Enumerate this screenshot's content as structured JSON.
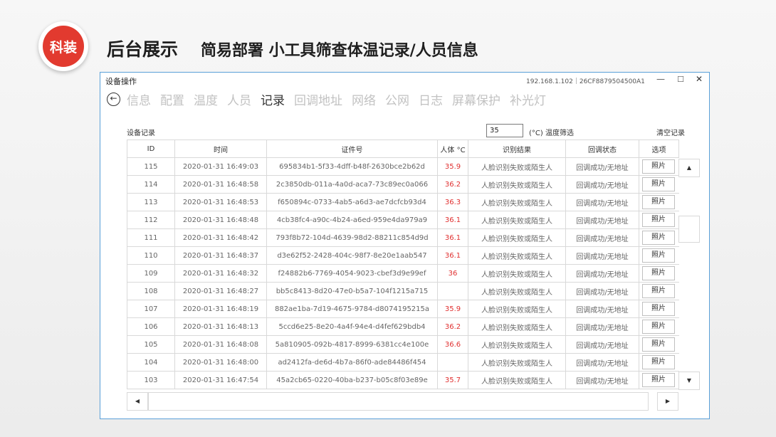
{
  "slide": {
    "badge": "科装",
    "title": "后台展示",
    "subtitle": "简易部署 小工具筛查体温记录/人员信息"
  },
  "window": {
    "title": "设备操作",
    "device_info": "192.168.1.102｜26CF8879504500A1",
    "controls": {
      "minimize": "—",
      "maximize": "☐",
      "close": "✕"
    }
  },
  "nav": {
    "back_icon": "←",
    "tabs": [
      "信息",
      "配置",
      "温度",
      "人员",
      "记录",
      "回调地址",
      "网络",
      "公网",
      "日志",
      "屏幕保护",
      "补光灯"
    ],
    "active_index": 4
  },
  "records": {
    "label": "设备记录",
    "temp_filter_value": "35",
    "temp_filter_label": "(°C) 温度筛选",
    "clear_label": "清空记录",
    "columns": [
      "ID",
      "时间",
      "证件号",
      "人体 °C",
      "识别结果",
      "回调状态",
      "选项"
    ],
    "photo_label": "照片",
    "rows": [
      {
        "id": "115",
        "time": "2020-01-31 16:49:03",
        "cert": "695834b1-5f33-4dff-b48f-2630bce2b62d",
        "temp": "35.9",
        "result": "人脸识别失败或陌生人",
        "callback": "回调成功/无地址"
      },
      {
        "id": "114",
        "time": "2020-01-31 16:48:58",
        "cert": "2c3850db-011a-4a0d-aca7-73c89ec0a066",
        "temp": "36.2",
        "result": "人脸识别失败或陌生人",
        "callback": "回调成功/无地址"
      },
      {
        "id": "113",
        "time": "2020-01-31 16:48:53",
        "cert": "f650894c-0733-4ab5-a6d3-ae7dcfcb93d4",
        "temp": "36.3",
        "result": "人脸识别失败或陌生人",
        "callback": "回调成功/无地址"
      },
      {
        "id": "112",
        "time": "2020-01-31 16:48:48",
        "cert": "4cb38fc4-a90c-4b24-a6ed-959e4da979a9",
        "temp": "36.1",
        "result": "人脸识别失败或陌生人",
        "callback": "回调成功/无地址"
      },
      {
        "id": "111",
        "time": "2020-01-31 16:48:42",
        "cert": "793f8b72-104d-4639-98d2-88211c854d9d",
        "temp": "36.1",
        "result": "人脸识别失败或陌生人",
        "callback": "回调成功/无地址"
      },
      {
        "id": "110",
        "time": "2020-01-31 16:48:37",
        "cert": "d3e62f52-2428-404c-98f7-8e20e1aab547",
        "temp": "36.1",
        "result": "人脸识别失败或陌生人",
        "callback": "回调成功/无地址"
      },
      {
        "id": "109",
        "time": "2020-01-31 16:48:32",
        "cert": "f24882b6-7769-4054-9023-cbef3d9e99ef",
        "temp": "36",
        "result": "人脸识别失败或陌生人",
        "callback": "回调成功/无地址"
      },
      {
        "id": "108",
        "time": "2020-01-31 16:48:27",
        "cert": "bb5c8413-8d20-47e0-b5a7-104f1215a715",
        "temp": "",
        "result": "人脸识别失败或陌生人",
        "callback": "回调成功/无地址"
      },
      {
        "id": "107",
        "time": "2020-01-31 16:48:19",
        "cert": "882ae1ba-7d19-4675-9784-d8074195215a",
        "temp": "35.9",
        "result": "人脸识别失败或陌生人",
        "callback": "回调成功/无地址"
      },
      {
        "id": "106",
        "time": "2020-01-31 16:48:13",
        "cert": "5ccd6e25-8e20-4a4f-94e4-d4fef629bdb4",
        "temp": "36.2",
        "result": "人脸识别失败或陌生人",
        "callback": "回调成功/无地址"
      },
      {
        "id": "105",
        "time": "2020-01-31 16:48:08",
        "cert": "5a810905-092b-4817-8999-6381cc4e100e",
        "temp": "36.6",
        "result": "人脸识别失败或陌生人",
        "callback": "回调成功/无地址"
      },
      {
        "id": "104",
        "time": "2020-01-31 16:48:00",
        "cert": "ad2412fa-de6d-4b7a-86f0-ade84486f454",
        "temp": "",
        "result": "人脸识别失败或陌生人",
        "callback": "回调成功/无地址"
      },
      {
        "id": "103",
        "time": "2020-01-31 16:47:54",
        "cert": "45a2cb65-0220-40ba-b237-b05c8f03e89e",
        "temp": "35.7",
        "result": "人脸识别失败或陌生人",
        "callback": "回调成功/无地址"
      }
    ]
  },
  "scrollbars": {
    "up": "▲",
    "down": "▼",
    "left": "◀",
    "right": "▶"
  },
  "colors": {
    "accent_red": "#e23a2f",
    "temp_red": "#e03030",
    "window_border": "#5aa0d8"
  }
}
